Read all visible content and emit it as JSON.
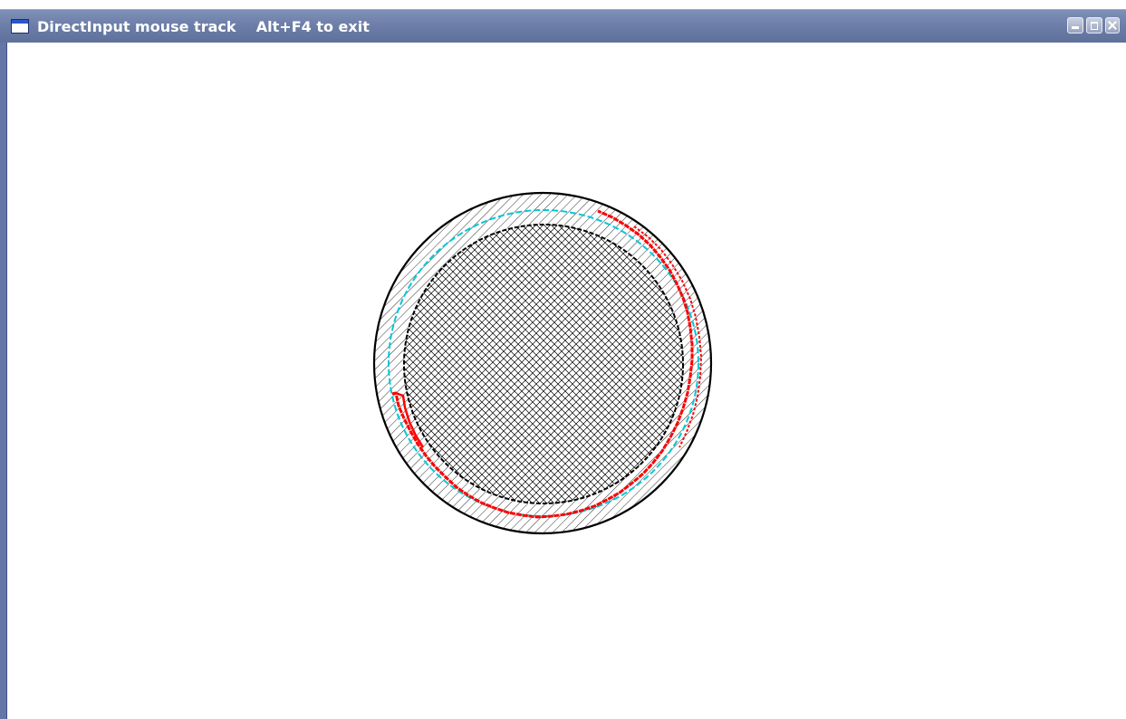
{
  "window": {
    "title": "DirectInput mouse track    Alt+F4 to exit",
    "controls": [
      "minimize",
      "maximize",
      "close"
    ]
  },
  "canvas": {
    "background": "#ffffff",
    "target_color": "#000000",
    "cursor_path_color": "#00c8d8",
    "mouse_track_color": "#ff0000"
  },
  "icons": {
    "app": "window-icon",
    "minimize": "minimize-icon",
    "maximize": "maximize-icon",
    "close": "close-icon"
  }
}
